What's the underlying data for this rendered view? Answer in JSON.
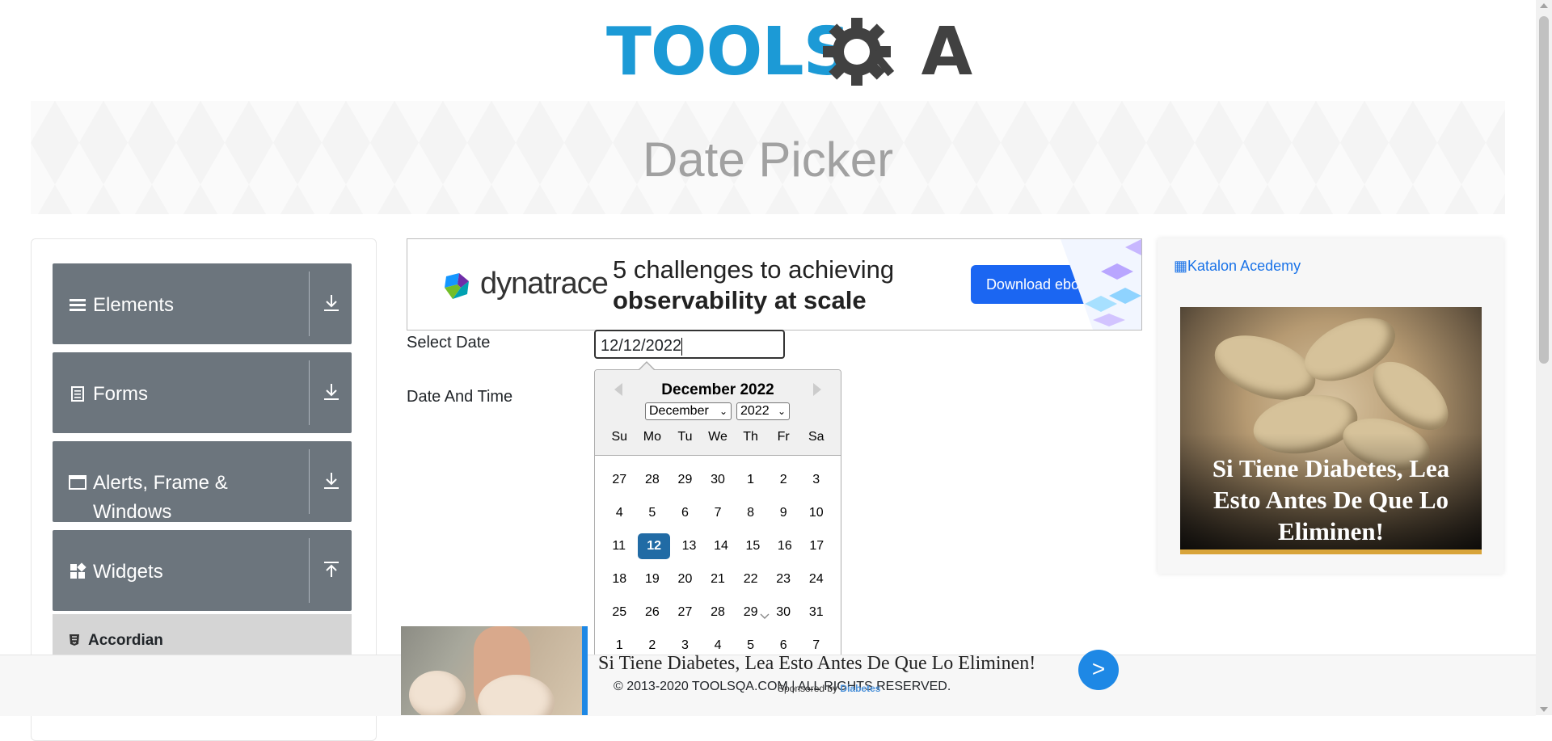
{
  "header": {
    "logo_text_main": "TOOLS",
    "logo_text_tail": "A",
    "page_title": "Date Picker"
  },
  "sidebar": {
    "groups": [
      {
        "label": "Elements",
        "icon": "hamburger-icon",
        "expanded": false
      },
      {
        "label": "Forms",
        "icon": "document-icon",
        "expanded": false
      },
      {
        "label": "Alerts, Frame & Windows",
        "icon": "window-icon",
        "expanded": false
      },
      {
        "label": "Widgets",
        "icon": "widgets-icon",
        "expanded": true
      }
    ],
    "sub_items": [
      {
        "label": "Accordian",
        "icon": "html5-icon"
      }
    ]
  },
  "ad": {
    "brand": "dynatrace",
    "headline_line1": "5 challenges to achieving",
    "headline_line2": "observability at scale",
    "cta": "Download ebook"
  },
  "form": {
    "select_date_label": "Select Date",
    "select_date_value": "12/12/2022",
    "date_time_label": "Date And Time"
  },
  "datepicker": {
    "title": "December 2022",
    "month_select": "December",
    "year_select": "2022",
    "day_names": [
      "Su",
      "Mo",
      "Tu",
      "We",
      "Th",
      "Fr",
      "Sa"
    ],
    "weeks": [
      [
        "27",
        "28",
        "29",
        "30",
        "1",
        "2",
        "3"
      ],
      [
        "4",
        "5",
        "6",
        "7",
        "8",
        "9",
        "10"
      ],
      [
        "11",
        "12",
        "13",
        "14",
        "15",
        "16",
        "17"
      ],
      [
        "18",
        "19",
        "20",
        "21",
        "22",
        "23",
        "24"
      ],
      [
        "25",
        "26",
        "27",
        "28",
        "29",
        "30",
        "31"
      ],
      [
        "1",
        "2",
        "3",
        "4",
        "5",
        "6",
        "7"
      ]
    ],
    "selected_day": "12"
  },
  "right_ad": {
    "alt_text": "Katalon Acedemy",
    "caption": "Si Tiene Diabetes, Lea Esto Antes De Que Lo Eliminen!"
  },
  "footer": {
    "copyright": "© 2013-2020 TOOLSQA.COM | ALL RIGHTS RESERVED.",
    "sponsored_prefix": "Sponsored by",
    "sponsored_brand": "Diabetes"
  },
  "bottom_ad": {
    "text": "Si Tiene Diabetes, Lea Esto Antes De Que Lo Eliminen!",
    "button": ">"
  },
  "colors": {
    "accent_blue": "#1c9ad6",
    "sidebar_grey": "#6c757d",
    "selected_day": "#216ba5",
    "ad_button": "#1b66f2"
  }
}
